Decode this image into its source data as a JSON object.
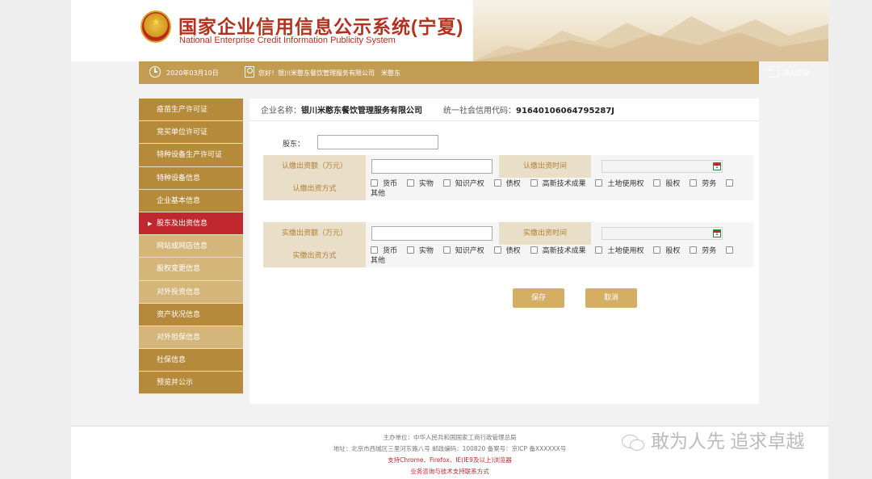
{
  "header": {
    "title_cn": "国家企业信用信息公示系统(宁夏)",
    "title_en": "National Enterprise Credit Information Publicity System",
    "emblem_icon": "national-emblem-icon"
  },
  "topbar": {
    "date": "2020年03月10日",
    "greeting": "您好！银川米憨东餐饮管理服务有限公司　米憨东",
    "logout_label": "退出登录"
  },
  "sidebar": {
    "items": [
      {
        "label": "疫苗生产许可证",
        "style": "dark"
      },
      {
        "label": "竞买单位许可证",
        "style": "dark"
      },
      {
        "label": "特种设备生产许可证",
        "style": "dark"
      },
      {
        "label": "特种设备信息",
        "style": "dark"
      },
      {
        "label": "企业基本信息",
        "style": "dark"
      },
      {
        "label": "股东及出资信息",
        "style": "active"
      },
      {
        "label": "网站或网店信息",
        "style": "light"
      },
      {
        "label": "股权变更信息",
        "style": "light"
      },
      {
        "label": "对外投资信息",
        "style": "light"
      },
      {
        "label": "资产状况信息",
        "style": "dark"
      },
      {
        "label": "对外担保信息",
        "style": "light"
      },
      {
        "label": "社保信息",
        "style": "dark"
      },
      {
        "label": "预览并公示",
        "style": "dark"
      }
    ]
  },
  "main": {
    "company_label": "企业名称：",
    "company_name": "银川米憨东餐饮管理服务有限公司",
    "credit_code_label": "统一社会信用代码：",
    "credit_code": "91640106064795287J",
    "shareholder_label": "股东：",
    "shareholder_value": "",
    "subscribed": {
      "amount_label": "认缴出资额（万元）",
      "amount_value": "",
      "time_label": "认缴出资时间",
      "time_value": "",
      "method_label": "认缴出资方式"
    },
    "paid": {
      "amount_label": "实缴出资额（万元）",
      "amount_value": "",
      "time_label": "实缴出资时间",
      "time_value": "",
      "method_label": "实缴出资方式"
    },
    "methods": [
      "货币",
      "实物",
      "知识产权",
      "债权",
      "高新技术成果",
      "土地使用权",
      "股权",
      "劳务"
    ],
    "other_method": "其他",
    "save_label": "保存",
    "cancel_label": "取消"
  },
  "footer": {
    "line1": "主办单位：中华人民共和国国家工商行政管理总局",
    "line2": "地址：北京市西城区三里河东路八号 邮政编码：100820 备案号：京ICP 备XXXXXX号",
    "line3": "支持Chrome、Firefox、IE(IE9及以上)浏览器",
    "line4": "业务咨询与技术支持联系方式"
  },
  "watermark": {
    "text": "敢为人先 追求卓越"
  },
  "colors": {
    "gold": "#c39c53",
    "sidebar_dark": "#b58a3a",
    "sidebar_light": "#d4b67a",
    "active": "#c1282d",
    "title_red": "#b5311f"
  }
}
